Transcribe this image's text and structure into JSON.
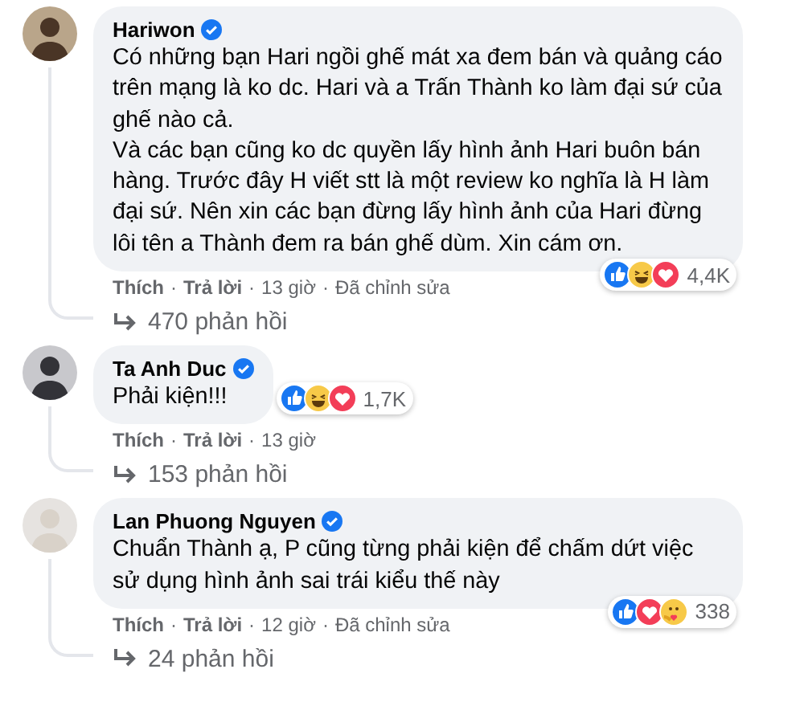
{
  "separator": "·",
  "comments": [
    {
      "author": "Hariwon",
      "verified": true,
      "paragraphs": [
        "Có những bạn Hari ngồi ghế mát xa đem bán và quảng cáo trên mạng là ko dc. Hari và a Trấn Thành ko làm đại sứ của ghế nào cả.",
        "Và các bạn cũng ko dc quyền lấy hình ảnh Hari buôn bán hàng. Trước đây H viết stt là một review ko nghĩa là H làm đại sứ. Nên xin các bạn đừng lấy hình ảnh của Hari đừng lôi tên a Thành đem ra bán ghế dùm. Xin cám ơn."
      ],
      "reactions": [
        {
          "kind": "like"
        },
        {
          "kind": "haha"
        },
        {
          "kind": "love"
        }
      ],
      "reaction_count": "4,4K",
      "reactions_beside": false,
      "like": "Thích",
      "reply": "Trả lời",
      "time": "13 giờ",
      "edited": "Đã chỉnh sửa",
      "replies": "470 phản hồi"
    },
    {
      "author": "Ta Anh Duc",
      "verified": true,
      "paragraphs": [
        "Phải kiện!!!"
      ],
      "reactions": [
        {
          "kind": "like"
        },
        {
          "kind": "haha"
        },
        {
          "kind": "love"
        }
      ],
      "reaction_count": "1,7K",
      "reactions_beside": true,
      "like": "Thích",
      "reply": "Trả lời",
      "time": "13 giờ",
      "replies": "153 phản hồi"
    },
    {
      "author": "Lan Phuong Nguyen",
      "verified": true,
      "paragraphs": [
        "Chuẩn Thành ạ, P cũng từng phải kiện để chấm dứt việc sử dụng hình ảnh sai trái kiểu thế này"
      ],
      "reactions": [
        {
          "kind": "like"
        },
        {
          "kind": "love"
        },
        {
          "kind": "care"
        }
      ],
      "reaction_count": "338",
      "reactions_beside": false,
      "like": "Thích",
      "reply": "Trả lời",
      "time": "12 giờ",
      "edited": "Đã chỉnh sửa",
      "replies": "24 phản hồi"
    }
  ]
}
